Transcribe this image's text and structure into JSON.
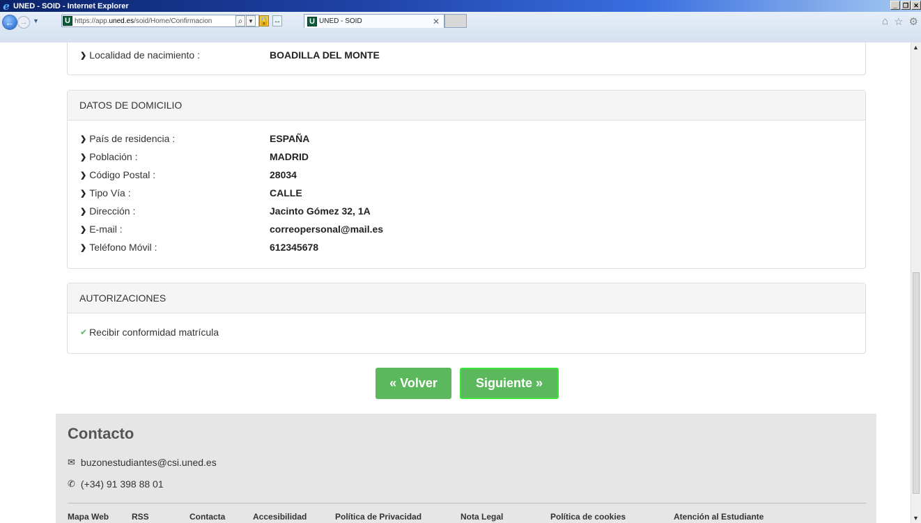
{
  "window": {
    "title": "UNED - SOID - Internet Explorer",
    "address": {
      "prefix": "https://app.",
      "host": "uned.es",
      "path": "/soid/Home/Confirmacion"
    },
    "tab_title": "UNED - SOID"
  },
  "datos_nacimiento": {
    "rows": [
      {
        "label": "Localidad de nacimiento :",
        "value": "BOADILLA DEL MONTE"
      }
    ]
  },
  "datos_domicilio": {
    "heading": "DATOS DE DOMICILIO",
    "rows": [
      {
        "label": "País de residencia :",
        "value": "ESPAÑA"
      },
      {
        "label": "Población :",
        "value": "MADRID"
      },
      {
        "label": "Código Postal :",
        "value": "28034"
      },
      {
        "label": "Tipo Vía :",
        "value": "CALLE"
      },
      {
        "label": "Dirección :",
        "value": "Jacinto Gómez 32, 1A"
      },
      {
        "label": "E-mail :",
        "value": "correopersonal@mail.es"
      },
      {
        "label": "Teléfono Móvil :",
        "value": "612345678"
      }
    ]
  },
  "autorizaciones": {
    "heading": "AUTORIZACIONES",
    "items": [
      "Recibir conformidad matrícula"
    ]
  },
  "buttons": {
    "volver": "« Volver",
    "siguiente": "Siguiente »"
  },
  "footer": {
    "heading": "Contacto",
    "email": "buzonestudiantes@csi.uned.es",
    "phone": "(+34) 91 398 88 01",
    "links": [
      "Mapa Web",
      "RSS",
      "Contacta",
      "Accesibilidad",
      "Política de Privacidad",
      "Nota Legal",
      "Política de cookies",
      "Atención al Estudiante"
    ]
  },
  "colors": {
    "primary_button": "#5cb85c",
    "focus_border": "#39e639",
    "panel_header": "#f5f5f5",
    "footer_bg": "#e6e6e6"
  }
}
